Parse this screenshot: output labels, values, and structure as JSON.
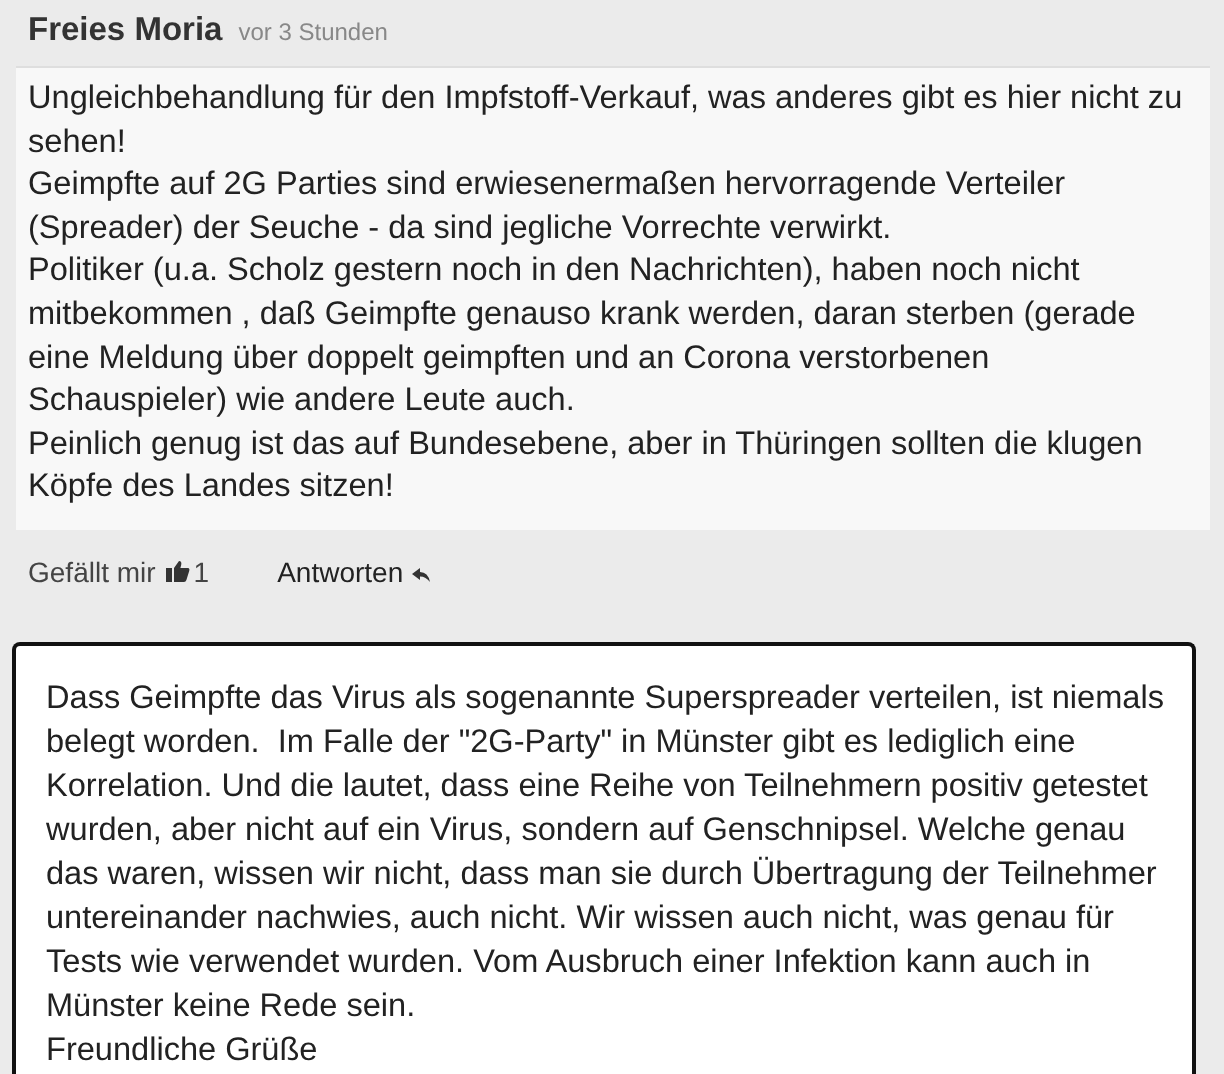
{
  "comment": {
    "author": "Freies Moria",
    "time": "vor 3 Stunden",
    "paragraphs": [
      "Ungleichbehandlung für den Impfstoff-Verkauf, was anderes gibt es hier nicht zu sehen!",
      "Geimpfte auf 2G Parties sind erwiesenermaßen hervorragende Verteiler (Spreader) der Seuche - da sind jegliche Vorrechte verwirkt.",
      "Politiker (u.a. Scholz gestern noch in den Nachrichten), haben noch nicht mitbekommen , daß Geimpfte genauso krank werden, daran sterben (gerade eine Meldung über doppelt geimpften und an Corona verstorbenen Schauspieler) wie andere Leute auch.",
      "Peinlich genug ist das auf Bundesebene, aber in Thüringen sollten die klugen Köpfe des Landes sitzen!"
    ],
    "like_label": "Gefällt mir",
    "like_count": "1",
    "reply_label": "Antworten"
  },
  "reply": {
    "value": "Dass Geimpfte das Virus als sogenannte Superspreader verteilen, ist niemals belegt worden.  Im Falle der \"2G-Party\" in Münster gibt es lediglich eine Korrelation. Und die lautet, dass eine Reihe von Teilnehmern positiv getestet wurden, aber nicht auf ein Virus, sondern auf Genschnipsel. Welche genau das waren, wissen wir nicht, dass man sie durch Übertragung der Teilnehmer untereinander nachwies, auch nicht. Wir wissen auch nicht, was genau für Tests wie verwendet wurden. Vom Ausbruch einer Infektion kann auch in Münster keine Rede sein.\nFreundliche Grüße"
  }
}
